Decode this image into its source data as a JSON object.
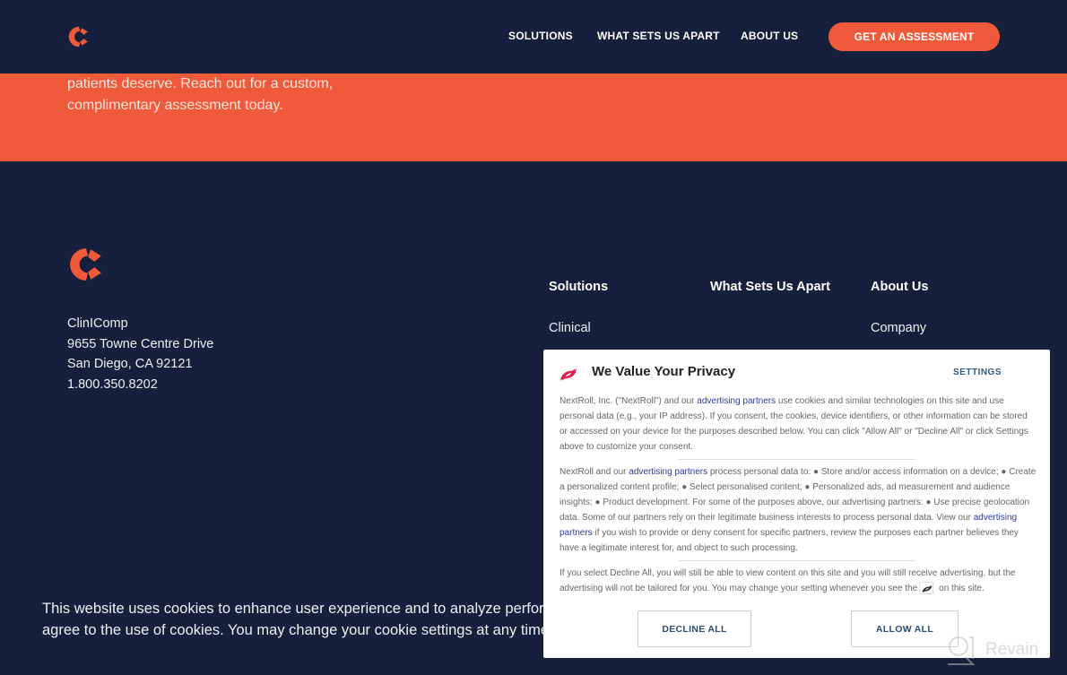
{
  "header": {
    "logo": "cliniccomp-logo-icon",
    "nav": [
      "SOLUTIONS",
      "WHAT SETS US APART",
      "ABOUT US"
    ],
    "cta": "GET AN ASSESSMENT"
  },
  "hero": {
    "line1": "patients deserve. Reach out for a custom,",
    "line2": "complimentary assessment today."
  },
  "footer": {
    "logo": "cliniccomp-logo-icon",
    "address": [
      "ClinIComp",
      "9655 Towne Centre Drive",
      "San Diego, CA 92121",
      "1.800.350.8202"
    ],
    "columns": [
      {
        "heading": "Solutions",
        "links": [
          "Clinical"
        ]
      },
      {
        "heading": "What Sets Us Apart",
        "links": []
      },
      {
        "heading": "About Us",
        "links": [
          "Company"
        ]
      }
    ]
  },
  "cookie_banner": {
    "line1": "This website uses cookies to enhance user experience and to analyze perfor",
    "line2": "agree to the use of cookies. You may change your cookie settings at any time"
  },
  "privacy_modal": {
    "icon": "nextroll-icon",
    "title": "We Value Your Privacy",
    "settings": "SETTINGS",
    "p1_a": "NextRoll, Inc. (\"NextRoll\") and our ",
    "p1_link": "advertising partners",
    "p1_b": " use cookies and similar technologies on this site and use personal data (e.g., your IP address). If you consent, the cookies, device identifiers, or other information can be stored or accessed on your device for the purposes described below. You can click \"Allow All\" or \"Decline All\" or click Settings above to customize your consent.",
    "p2_a": "NextRoll and our ",
    "p2_link1": "advertising partners",
    "p2_b": " process personal data to: ● Store and/or access information on a device; ● Create a personalized content profile; ● Select personalised content; ● Personalized ads, ad measurement and audience insights; ● Product development. For some of the purposes above, our advertising partners: ● Use precise geolocation data. Some of our partners rely on their legitimate business interests to process personal data. View our ",
    "p2_link2": "advertising partners",
    "p2_c": " if you wish to provide or deny consent for specific partners, review the purposes each partner believes they have a legitimate interest for, and object to such processing.",
    "p3_a": "If you select Decline All, you will still be able to view content on this site and you will still receive advertising, but the advertising will not be tailored for you. You may change your setting whenever you see the",
    "p3_b": "on this site.",
    "decline": "DECLINE ALL",
    "allow": "ALLOW ALL"
  },
  "watermark": "Revain",
  "colors": {
    "navy": "#161f3b",
    "orange": "#ef5a3b",
    "link_blue": "#2a3a9c",
    "nextroll_pink": "#e0234f"
  }
}
